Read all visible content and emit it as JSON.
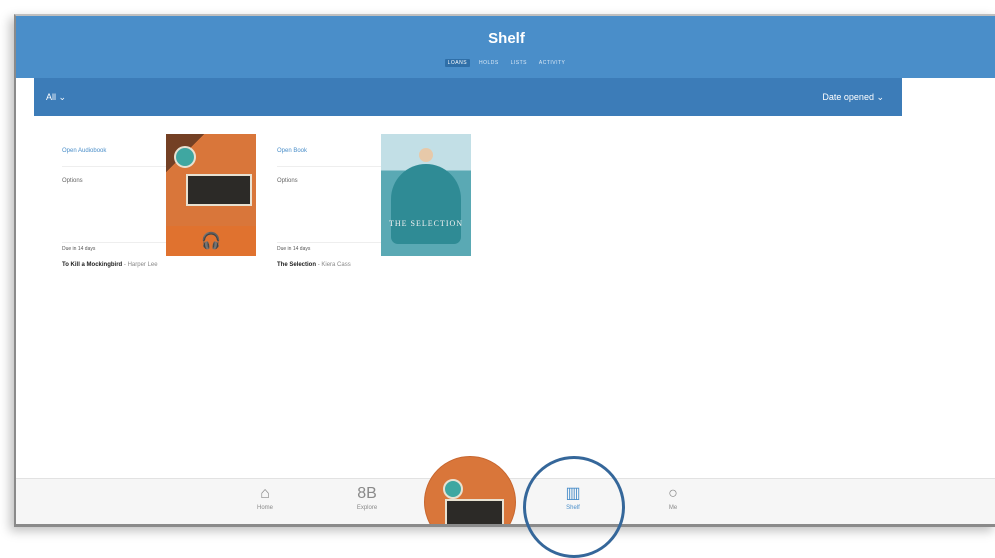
{
  "header": {
    "title": "Shelf",
    "tabs": [
      {
        "label": "Loans",
        "active": true
      },
      {
        "label": "Holds",
        "active": false
      },
      {
        "label": "Lists",
        "active": false
      },
      {
        "label": "Activity",
        "active": false
      }
    ]
  },
  "filter_bar": {
    "filter": "All ⌄",
    "sort": "Date opened ⌄"
  },
  "items": [
    {
      "open_label": "Open Audiobook",
      "options_label": "Options",
      "due": "Due in 14 days",
      "title": "To Kill a Mockingbird",
      "author": "- Harper Lee",
      "format_icon": "headphones-icon"
    },
    {
      "open_label": "Open Book",
      "options_label": "Options",
      "due": "Due in 14 days",
      "title": "The Selection",
      "author": "- Kiera Cass",
      "cover_text": "THE SELECTION"
    }
  ],
  "tabbar": {
    "items": [
      {
        "label": "Home",
        "icon": "home-icon",
        "active": false
      },
      {
        "label": "Explore",
        "icon": "explore-icon",
        "active": false
      },
      {
        "label": "Shelf",
        "icon": "shelf-icon",
        "active": true
      },
      {
        "label": "Me",
        "icon": "me-icon",
        "active": false
      }
    ]
  },
  "colors": {
    "header": "#4a8ec9",
    "filter_bar": "#3c7cb8",
    "accent": "#4a8ec9",
    "highlight_ring": "#35679a"
  }
}
